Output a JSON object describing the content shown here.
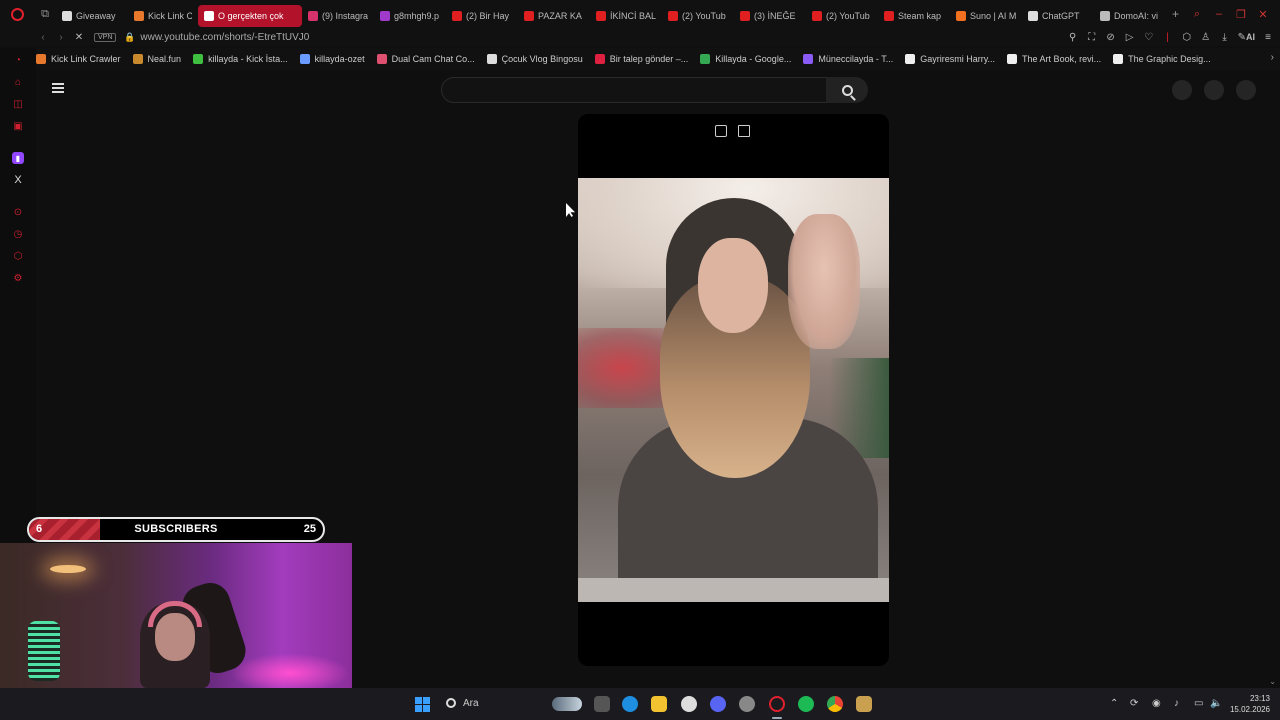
{
  "browser": {
    "tabs": [
      {
        "label": "Giveaway",
        "color": "#dddddd",
        "width": 72
      },
      {
        "label": "Kick Link C",
        "color": "#e8782c",
        "width": 70
      },
      {
        "label": "O gerçekten çok",
        "color": "#ffffff",
        "width": 104,
        "active": true
      },
      {
        "label": "(9) Instagra",
        "color": "#d6336c",
        "width": 72
      },
      {
        "label": "g8mhgh9.p",
        "color": "#a03acb",
        "width": 72
      },
      {
        "label": "(2) Bir Hay",
        "color": "#e02020",
        "width": 72
      },
      {
        "label": "PAZAR KA",
        "color": "#e02020",
        "width": 72
      },
      {
        "label": "İKİNCİ BAL",
        "color": "#e02020",
        "width": 72
      },
      {
        "label": "(2) YouTub",
        "color": "#e02020",
        "width": 72
      },
      {
        "label": "(3) İNEĞE",
        "color": "#e02020",
        "width": 72
      },
      {
        "label": "(2) YouTub",
        "color": "#e02020",
        "width": 72
      },
      {
        "label": "Steam kap",
        "color": "#e02020",
        "width": 72
      },
      {
        "label": "Suno | AI M",
        "color": "#f07020",
        "width": 72
      },
      {
        "label": "ChatGPT",
        "color": "#dddddd",
        "width": 72
      },
      {
        "label": "DomoAI: vi",
        "color": "#bbbbbb",
        "width": 72
      }
    ],
    "url": "www.youtube.com/shorts/-EtreTtUVJ0",
    "vpn_label": "VPN",
    "ai_label": "AI",
    "bookmarks": [
      {
        "label": "Kick Link Crawler",
        "color": "#e8782c"
      },
      {
        "label": "Neal.fun",
        "color": "#c88a2c"
      },
      {
        "label": "killayda - Kick İsta...",
        "color": "#3fbf3f"
      },
      {
        "label": "killayda-ozet",
        "color": "#6a9cff"
      },
      {
        "label": "Dual Cam Chat Co...",
        "color": "#e05070"
      },
      {
        "label": "Çocuk Vlog Bingosu",
        "color": "#dddddd"
      },
      {
        "label": "Bir talep gönder –...",
        "color": "#e02040"
      },
      {
        "label": "Killayda - Google...",
        "color": "#35a853"
      },
      {
        "label": "Müneccilayda - T...",
        "color": "#8a5cf5"
      },
      {
        "label": "Gayriresmi Harry...",
        "color": "#f0f0f0"
      },
      {
        "label": "The Art Book, revi...",
        "color": "#f0f0f0"
      },
      {
        "label": "The Graphic Desig...",
        "color": "#f0f0f0"
      }
    ]
  },
  "youtube": {
    "search_placeholder": ""
  },
  "overlay": {
    "subs_current": "6",
    "subs_title": "SUBSCRIBERS",
    "subs_goal": "25",
    "subs_progress": 0.24,
    "bar_color": "#a8202e"
  },
  "taskbar": {
    "search_label": "Ara",
    "time": "23:13",
    "date": "15.02.2026"
  }
}
